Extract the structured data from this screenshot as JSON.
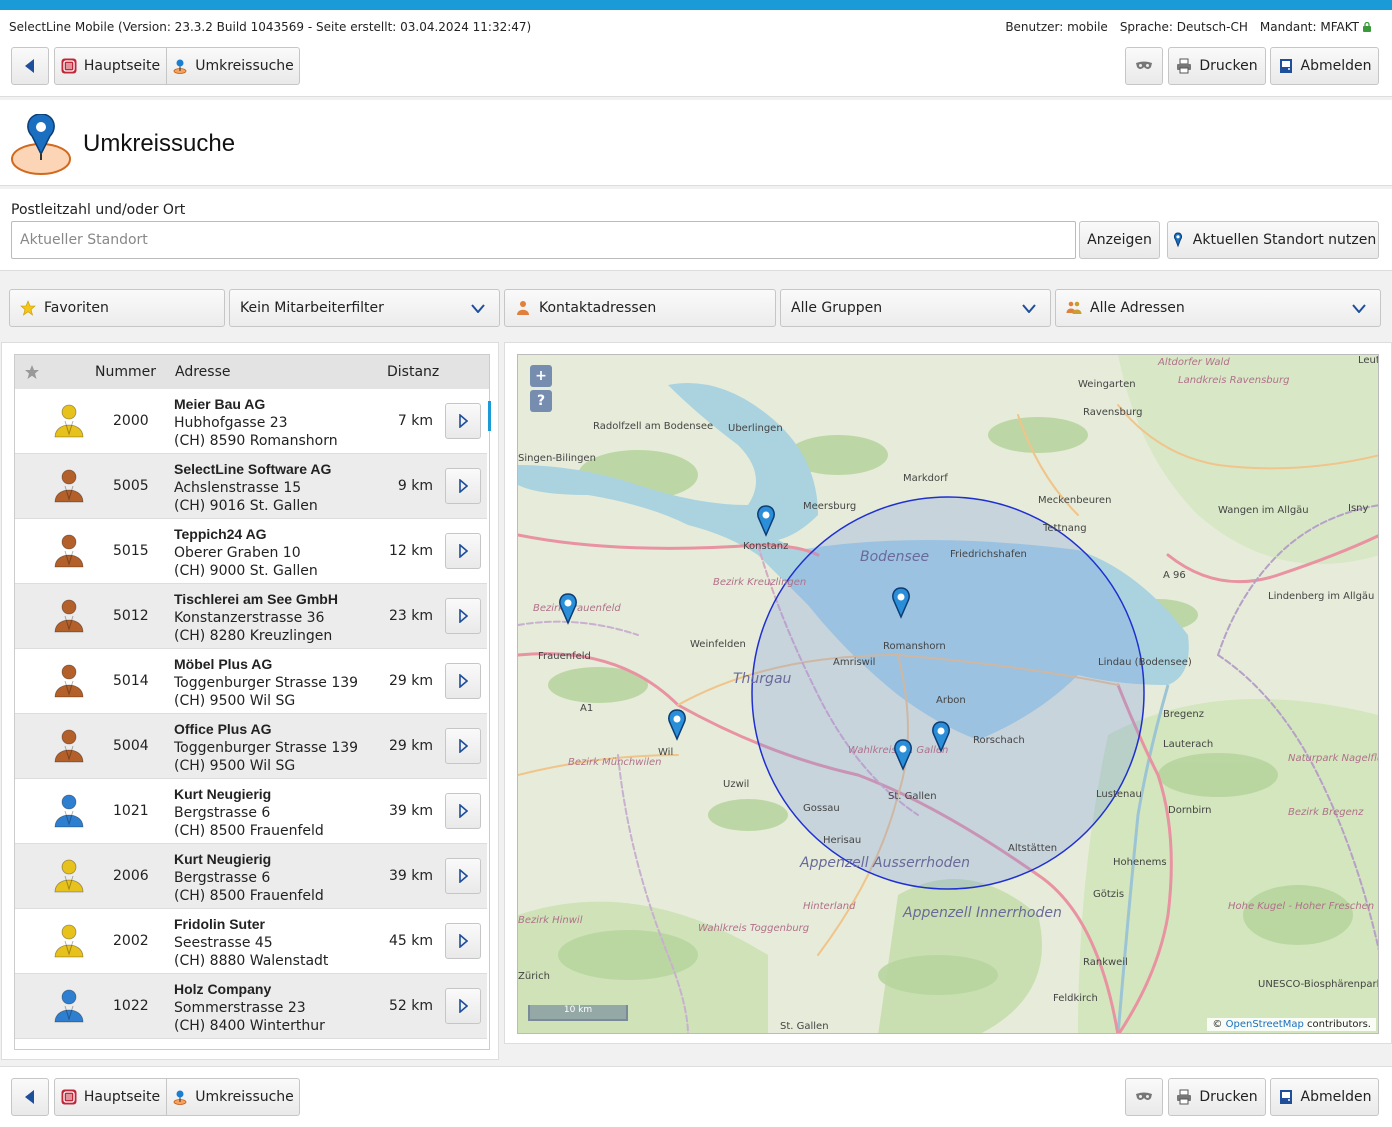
{
  "app": {
    "info": "SelectLine Mobile (Version: 23.3.2 Build 1043569 - Seite erstellt: 03.04.2024 11:32:47)",
    "user": "Benutzer: mobile",
    "language": "Sprache: Deutsch-CH",
    "client": "Mandant: MFAKT"
  },
  "nav": {
    "home_label": "Hauptseite",
    "current_label": "Umkreissuche",
    "print_label": "Drucken",
    "logout_label": "Abmelden"
  },
  "page": {
    "title": "Umkreissuche"
  },
  "search": {
    "label": "Postleitzahl und/oder Ort",
    "placeholder": "Aktueller Standort",
    "value": "",
    "show_label": "Anzeigen",
    "location_label": "Aktuellen Standort nutzen"
  },
  "filters": {
    "favorites": "Favoriten",
    "employee": "Kein Mitarbeiterfilter",
    "contacts": "Kontaktadressen",
    "groups": "Alle Gruppen",
    "addresses": "Alle Adressen"
  },
  "table": {
    "headers": {
      "number": "Nummer",
      "address": "Adresse",
      "distance": "Distanz"
    },
    "rows": [
      {
        "icon": "person-yellow-icon",
        "color": "#e8c21c",
        "number": "2000",
        "name": "Meier Bau AG",
        "street": "Hubhofgasse 23",
        "city": "(CH) 8590 Romanshorn",
        "distance": "7 km"
      },
      {
        "icon": "person-brown-icon",
        "color": "#b3602a",
        "number": "5005",
        "name": "SelectLine Software AG",
        "street": "Achslenstrasse 15",
        "city": "(CH) 9016 St. Gallen",
        "distance": "9 km"
      },
      {
        "icon": "person-brown-icon",
        "color": "#b3602a",
        "number": "5015",
        "name": "Teppich24 AG",
        "street": "Oberer Graben 10",
        "city": "(CH) 9000 St. Gallen",
        "distance": "12 km"
      },
      {
        "icon": "person-brown-icon",
        "color": "#b3602a",
        "number": "5012",
        "name": "Tischlerei am See GmbH",
        "street": "Konstanzerstrasse 36",
        "city": "(CH) 8280 Kreuzlingen",
        "distance": "23 km"
      },
      {
        "icon": "person-brown-icon",
        "color": "#b3602a",
        "number": "5014",
        "name": "Möbel Plus AG",
        "street": "Toggenburger Strasse 139",
        "city": "(CH) 9500 Wil SG",
        "distance": "29 km"
      },
      {
        "icon": "person-brown-icon",
        "color": "#b3602a",
        "number": "5004",
        "name": "Office Plus AG",
        "street": "Toggenburger Strasse 139",
        "city": "(CH) 9500 Wil SG",
        "distance": "29 km"
      },
      {
        "icon": "person-blue-icon",
        "color": "#2f7fd0",
        "number": "1021",
        "name": "Kurt Neugierig",
        "street": "Bergstrasse 6",
        "city": "(CH) 8500 Frauenfeld",
        "distance": "39 km"
      },
      {
        "icon": "person-yellow-icon",
        "color": "#e8c21c",
        "number": "2006",
        "name": "Kurt Neugierig",
        "street": "Bergstrasse 6",
        "city": "(CH) 8500 Frauenfeld",
        "distance": "39 km"
      },
      {
        "icon": "person-yellow-icon",
        "color": "#e8c21c",
        "number": "2002",
        "name": "Fridolin Suter",
        "street": "Seestrasse 45",
        "city": "(CH) 8880 Walenstadt",
        "distance": "45 km"
      },
      {
        "icon": "person-blue-icon",
        "color": "#2f7fd0",
        "number": "1022",
        "name": "Holz Company",
        "street": "Sommerstrasse 23",
        "city": "(CH) 8400 Winterthur",
        "distance": "52 km"
      }
    ]
  },
  "map": {
    "zoom_in": "+",
    "zoom_help": "?",
    "scale": "10 km",
    "attribution_prefix": "©",
    "attribution_link": "OpenStreetMap",
    "attribution_suffix": "contributors.",
    "lake": "Bodensee",
    "places": [
      "Altdorfer Wald",
      "Weingarten",
      "Landkreis Ravensburg",
      "Ravensburg",
      "Uberlingen",
      "Radolfzell am Bodensee",
      "Singen-Bilingen",
      "Markdorf",
      "Meersburg",
      "Meckenbeuren",
      "Tettnang",
      "Wangen im Allgäu",
      "Konstanz",
      "Friedrichshafen",
      "Bezirk Kreuzlingen",
      "A 96",
      "Lindenberg im Allgäu",
      "Bezirk Frauenfeld",
      "Frauenfeld",
      "Weinfelden",
      "Romanshorn",
      "Amriswil",
      "Thurgau",
      "Lindau (Bodensee)",
      "Arbon",
      "A1",
      "Bregenz",
      "Lauterach",
      "Rorschach",
      "Wil",
      "Bezirk Münchwilen",
      "Wahlkreis St. Gallen",
      "Uzwil",
      "St. Gallen",
      "Gossau",
      "Lustenau",
      "Dornbirn",
      "Naturpark Nagelfluhkette",
      "Bezirk Bregenz",
      "Herisau",
      "Altstätten",
      "Appenzell Ausserrhoden",
      "Hohenems",
      "Götzis",
      "Hinterland",
      "Appenzell Innerrhoden",
      "Wahlkreis Toggenburg",
      "Hohe Kugel - Hoher Freschen - Mellental",
      "Rankweil",
      "UNESCO-Biosphärenpark Großes",
      "Feldkirch",
      "Zürich",
      "Bezirk Hinwil",
      "St. Gallen",
      "Isny",
      "Leutkirch im Allgäu"
    ]
  }
}
